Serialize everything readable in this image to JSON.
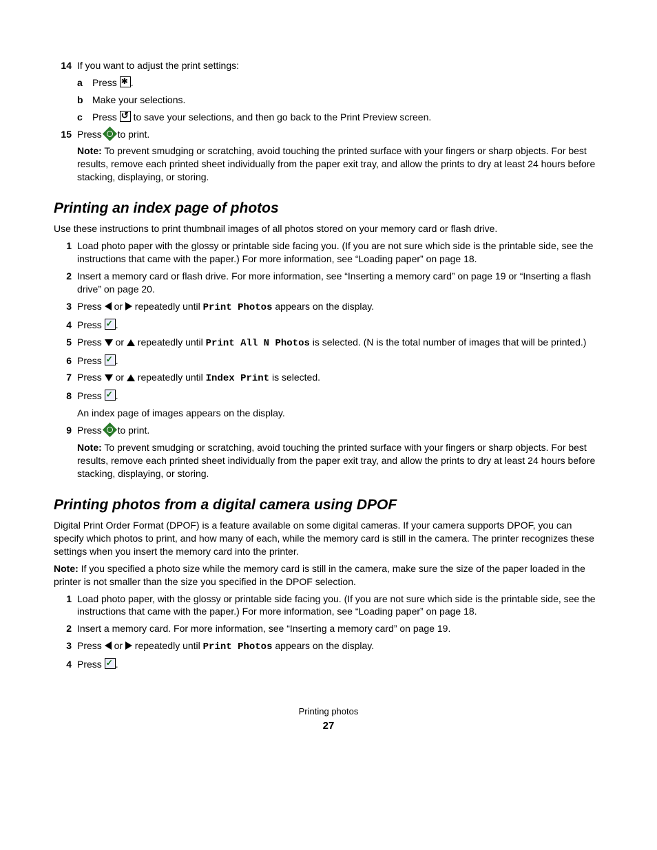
{
  "top": {
    "step14": {
      "num": "14",
      "text": "If you want to adjust the print settings:",
      "a": {
        "num": "a",
        "pre": "Press ",
        "post": "."
      },
      "b": {
        "num": "b",
        "text": "Make your selections."
      },
      "c": {
        "num": "c",
        "pre": "Press ",
        "post": " to save your selections, and then go back to the Print Preview screen."
      }
    },
    "step15": {
      "num": "15",
      "pre": "Press ",
      "post": " to print.",
      "noteLabel": "Note:",
      "noteText": " To prevent smudging or scratching, avoid touching the printed surface with your fingers or sharp objects. For best results, remove each printed sheet individually from the paper exit tray, and allow the prints to dry at least 24 hours before stacking, displaying, or storing."
    }
  },
  "sec1": {
    "heading": "Printing an index page of photos",
    "intro": "Use these instructions to print thumbnail images of all photos stored on your memory card or flash drive.",
    "s1": {
      "num": "1",
      "text": "Load photo paper with the glossy or printable side facing you. (If you are not sure which side is the printable side, see the instructions that came with the paper.) For more information, see “Loading paper” on page 18."
    },
    "s2": {
      "num": "2",
      "text": "Insert a memory card or flash drive. For more information, see “Inserting a memory card” on page 19 or “Inserting a flash drive” on page 20."
    },
    "s3": {
      "num": "3",
      "pre": "Press ",
      "mid1": " or ",
      "mid2": " repeatedly until ",
      "mono": "Print Photos",
      "post": " appears on the display."
    },
    "s4": {
      "num": "4",
      "pre": "Press ",
      "post": "."
    },
    "s5": {
      "num": "5",
      "pre": "Press ",
      "mid1": " or ",
      "mid2": " repeatedly until ",
      "mono": "Print All N Photos",
      "post": " is selected. (N is the total number of images that will be printed.)"
    },
    "s6": {
      "num": "6",
      "pre": "Press ",
      "post": "."
    },
    "s7": {
      "num": "7",
      "pre": "Press ",
      "mid1": " or ",
      "mid2": " repeatedly until ",
      "mono": "Index Print",
      "post": " is selected."
    },
    "s8": {
      "num": "8",
      "pre": "Press ",
      "post": ".",
      "after": "An index page of images appears on the display."
    },
    "s9": {
      "num": "9",
      "pre": "Press ",
      "post": " to print.",
      "noteLabel": "Note:",
      "noteText": " To prevent smudging or scratching, avoid touching the printed surface with your fingers or sharp objects. For best results, remove each printed sheet individually from the paper exit tray, and allow the prints to dry at least 24 hours before stacking, displaying, or storing."
    }
  },
  "sec2": {
    "heading": "Printing photos from a digital camera using DPOF",
    "intro": "Digital Print Order Format (DPOF) is a feature available on some digital cameras. If your camera supports DPOF, you can specify which photos to print, and how many of each, while the memory card is still in the camera. The printer recognizes these settings when you insert the memory card into the printer.",
    "noteLabel": "Note:",
    "noteText": " If you specified a photo size while the memory card is still in the camera, make sure the size of the paper loaded in the printer is not smaller than the size you specified in the DPOF selection.",
    "s1": {
      "num": "1",
      "text": "Load photo paper, with the glossy or printable side facing you. (If you are not sure which side is the printable side, see the instructions that came with the paper.) For more information, see “Loading paper” on page 18."
    },
    "s2": {
      "num": "2",
      "text": "Insert a memory card. For more information, see “Inserting a memory card” on page 19."
    },
    "s3": {
      "num": "3",
      "pre": "Press ",
      "mid1": " or ",
      "mid2": " repeatedly until ",
      "mono": "Print Photos",
      "post": " appears on the display."
    },
    "s4": {
      "num": "4",
      "pre": "Press ",
      "post": "."
    }
  },
  "footer": {
    "section": "Printing photos",
    "page": "27"
  }
}
